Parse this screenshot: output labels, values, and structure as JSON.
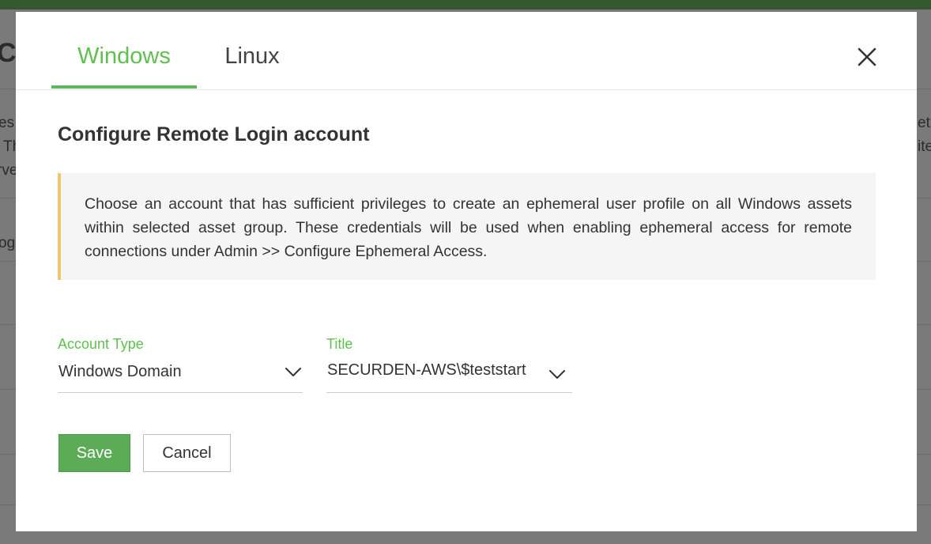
{
  "background": {
    "fragments_left": [
      "Co",
      "es",
      "Th",
      "rve",
      "og"
    ],
    "fragments_right": [
      "et",
      "ite"
    ]
  },
  "modal": {
    "tabs": [
      {
        "label": "Windows",
        "active": true
      },
      {
        "label": "Linux",
        "active": false
      }
    ],
    "title": "Configure Remote Login account",
    "info": "Choose an account that has sufficient privileges to create an ephemeral user profile on all Windows assets within selected asset group. These credentials will be used when enabling ephemeral access for remote connections under Admin >> Configure Ephemeral Access.",
    "fields": {
      "account_type": {
        "label": "Account Type",
        "value": "Windows Domain"
      },
      "title": {
        "label": "Title",
        "value": "SECURDEN-AWS\\$teststart"
      }
    },
    "buttons": {
      "save": "Save",
      "cancel": "Cancel"
    }
  },
  "colors": {
    "accent": "#5fc04e",
    "save_button": "#5cab57",
    "info_border": "#f2c46d",
    "top_bar": "#34572d"
  },
  "icons": {
    "close": "close-icon",
    "dropdown": "chevron-down-icon"
  }
}
